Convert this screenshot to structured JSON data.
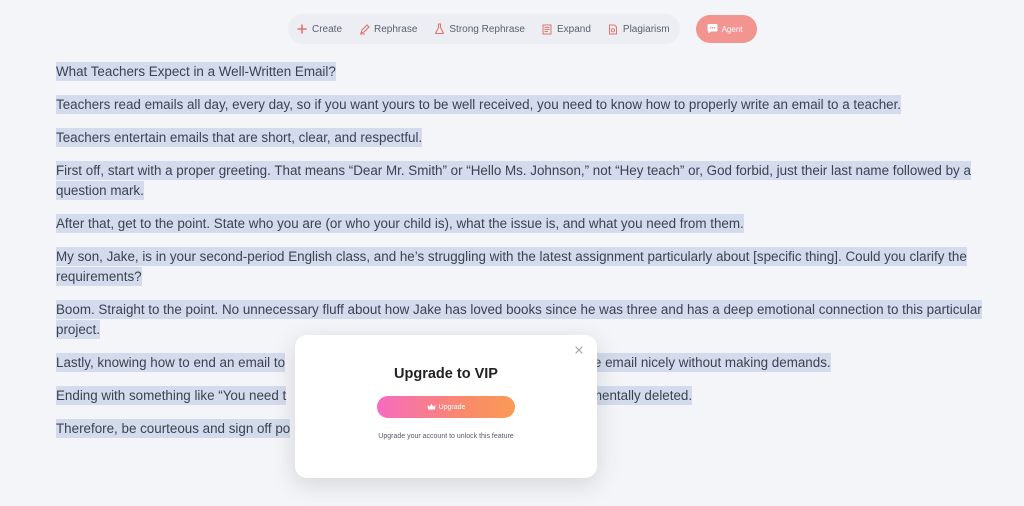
{
  "toolbar": {
    "items": [
      {
        "label": "Create",
        "icon": "plus-icon"
      },
      {
        "label": "Rephrase",
        "icon": "pen-icon"
      },
      {
        "label": "Strong Rephrase",
        "icon": "flask-icon"
      },
      {
        "label": "Expand",
        "icon": "list-icon"
      },
      {
        "label": "Plagiarism",
        "icon": "document-check-icon"
      }
    ],
    "agent": {
      "label": "Agent",
      "icon": "chat-bubble-icon"
    }
  },
  "document": {
    "paragraphs": [
      "What Teachers Expect in a Well-Written Email?",
      "Teachers read emails all day, every day, so if you want yours to be well received, you need to know how to properly write an email to a teacher.",
      "Teachers entertain emails that are short, clear, and respectful.",
      "First off, start with a proper greeting. That means “Dear Mr. Smith” or “Hello Ms. Johnson,” not “Hey teach” or, God forbid, just their last name followed by a question mark.",
      "After that, get to the point. State who you are (or who your child is), what the issue is, and what you need from them.",
      "My son, Jake, is in your second-period English class, and he’s struggling with the latest assignment particularly about [specific thing]. Could you clarify the requirements?",
      "Boom. Straight to the point. No unnecessary fluff about how Jake has loved books since he was three and has a deep emotional connection to this particular project.",
      "Lastly, knowing how to end an email to",
      "Ending with something like “You need t",
      "Therefore, be courteous and sign off po"
    ],
    "hidden_tails": {
      "p8": "wrap the email nicely without making demands.",
      "p9": "nail mentally deleted."
    }
  },
  "modal": {
    "title": "Upgrade to VIP",
    "button_label": "Upgrade",
    "button_icon": "crown-icon",
    "note": "Upgrade your account to unlock this feature",
    "close_icon": "close-icon"
  },
  "colors": {
    "background": "#f4f5f8",
    "highlight": "#d3dbec",
    "agent": "#f2948f",
    "upgrade_gradient_start": "#f76bc0",
    "upgrade_gradient_end": "#fb9a55",
    "tool_icon": "#e0756b"
  }
}
